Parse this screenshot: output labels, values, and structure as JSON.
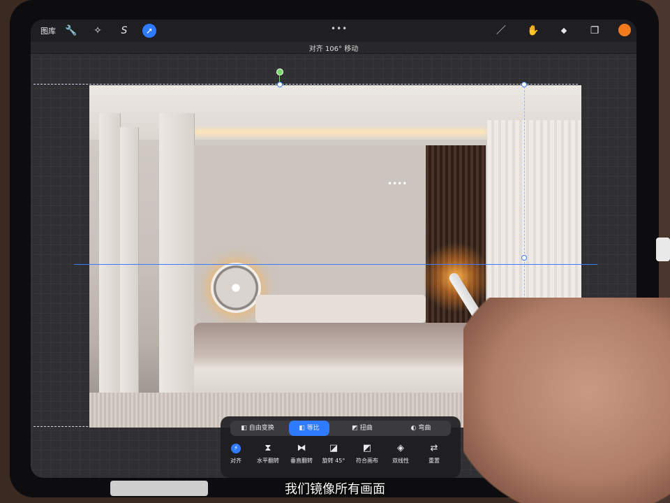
{
  "topbar": {
    "gallery_label": "图库",
    "tools": [
      {
        "icon": "wrench-icon",
        "glyph": "🔧"
      },
      {
        "icon": "magic-wand-icon",
        "glyph": "✧"
      },
      {
        "icon": "selection-s-icon",
        "glyph": "S"
      },
      {
        "icon": "transform-arrow-icon",
        "glyph": "➚"
      }
    ],
    "more_dots": "•••",
    "right_tools": [
      {
        "icon": "brush-icon",
        "glyph": "／"
      },
      {
        "icon": "smudge-icon",
        "glyph": "✋"
      },
      {
        "icon": "eraser-icon",
        "glyph": "◆"
      },
      {
        "icon": "layers-icon",
        "glyph": "❐"
      }
    ],
    "color_swatch": "#f07a1c"
  },
  "status": {
    "text": "对齐 106° 移动"
  },
  "canvas": {
    "handle_dots": "••••"
  },
  "transform_toolbar": {
    "modes": [
      {
        "label": "自由变换",
        "icon": "free-transform-icon",
        "glyph": "◧"
      },
      {
        "label": "等比",
        "icon": "uniform-icon",
        "glyph": "◧",
        "active": true
      },
      {
        "label": "扭曲",
        "icon": "distort-icon",
        "glyph": "◩"
      },
      {
        "label": "弯曲",
        "icon": "warp-icon",
        "glyph": "◐"
      }
    ],
    "actions": [
      {
        "label": "对齐",
        "icon": "snap-icon",
        "glyph": "⚡"
      },
      {
        "label": "水平翻转",
        "icon": "flip-horizontal-icon",
        "glyph": "⧗"
      },
      {
        "label": "垂直翻转",
        "icon": "flip-vertical-icon",
        "glyph": "⧓"
      },
      {
        "label": "旋转 45°",
        "icon": "rotate-icon",
        "glyph": "◪"
      },
      {
        "label": "符合画布",
        "icon": "fit-canvas-icon",
        "glyph": "◩"
      },
      {
        "label": "双线性",
        "icon": "bilinear-icon",
        "glyph": "◈"
      },
      {
        "label": "重置",
        "icon": "reset-icon",
        "glyph": "⇄"
      }
    ]
  },
  "subtitle": "我们镜像所有画面",
  "colors": {
    "accent": "#2f7bff",
    "guide": "#3b7bff",
    "rotate_handle": "#7bd86a"
  }
}
